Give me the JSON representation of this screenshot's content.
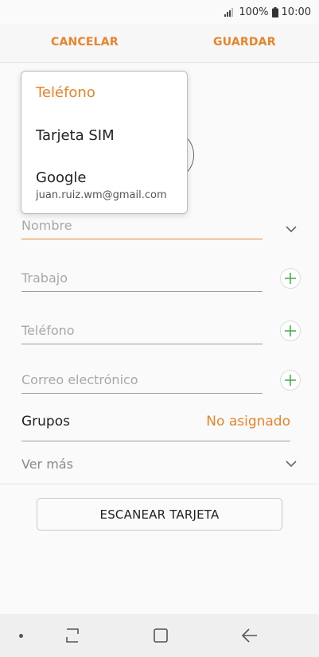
{
  "status": {
    "battery": "100%",
    "time": "10:00",
    "icons": [
      "signal-icon",
      "battery-icon"
    ]
  },
  "actionbar": {
    "cancel_label": "CANCELAR",
    "save_label": "GUARDAR"
  },
  "form": {
    "name_placeholder": "Nombre",
    "work_placeholder": "Trabajo",
    "phone_placeholder": "Teléfono",
    "email_placeholder": "Correo electrónico",
    "groups_label": "Grupos",
    "groups_value": "No asignado",
    "more_label": "Ver más",
    "scan_label": "ESCANEAR TARJETA"
  },
  "storage_menu": {
    "items": [
      {
        "label": "Teléfono",
        "selected": true
      },
      {
        "label": "Tarjeta SIM",
        "selected": false
      },
      {
        "label": "Google",
        "sub": "juan.ruiz.wm@gmail.com",
        "selected": false
      }
    ]
  },
  "colors": {
    "accent": "#e8842b",
    "plus": "#4caf50"
  }
}
